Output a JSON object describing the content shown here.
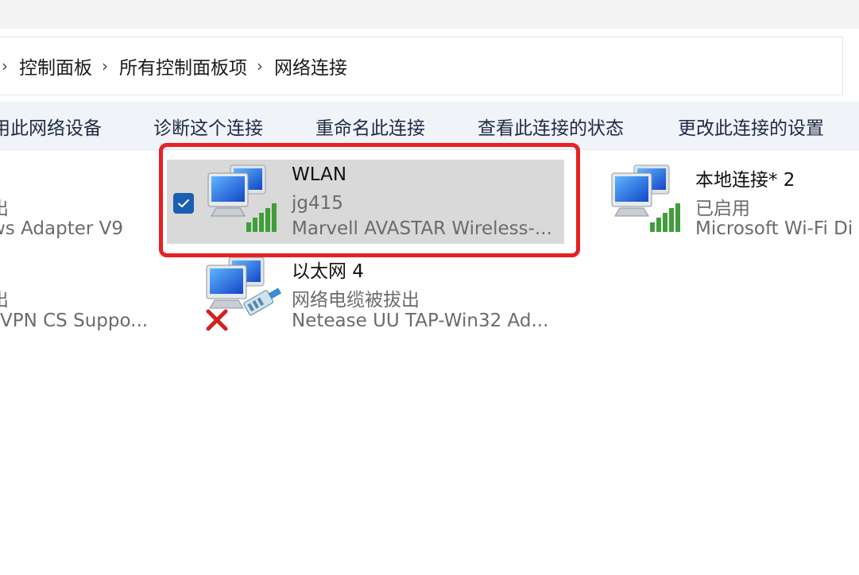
{
  "breadcrumb": {
    "items": [
      "控制面板",
      "所有控制面板项",
      "网络连接"
    ],
    "separator": "›"
  },
  "toolbar": {
    "commands": [
      "用此网络设备",
      "诊断这个连接",
      "重命名此连接",
      "查看此连接的状态",
      "更改此连接的设置"
    ]
  },
  "connections": [
    {
      "name": "",
      "status": "出",
      "device": "ws Adapter V9"
    },
    {
      "name": "WLAN",
      "status": "jg415",
      "device": "Marvell AVASTAR Wireless-...",
      "selected": true
    },
    {
      "name": "本地连接* 2",
      "status": "已启用",
      "device": "Microsoft Wi-Fi Di"
    },
    {
      "name": "",
      "status": "出",
      "device": "VPN CS Suppo..."
    },
    {
      "name": "以太网 4",
      "status": "网络电缆被拔出",
      "device": "Netease UU TAP-Win32 Ad..."
    }
  ],
  "colors": {
    "highlight_border": "#e52222",
    "selection_bg": "#d9d9d9",
    "checkbox": "#1a5fb4",
    "signal_green": "#3f9e3a",
    "error_red": "#d42020"
  },
  "icons": {
    "wireless": "network-computers-wireless-icon",
    "wired_unplugged": "network-computers-cable-unplugged-icon",
    "checkbox": "checkmark-icon"
  }
}
